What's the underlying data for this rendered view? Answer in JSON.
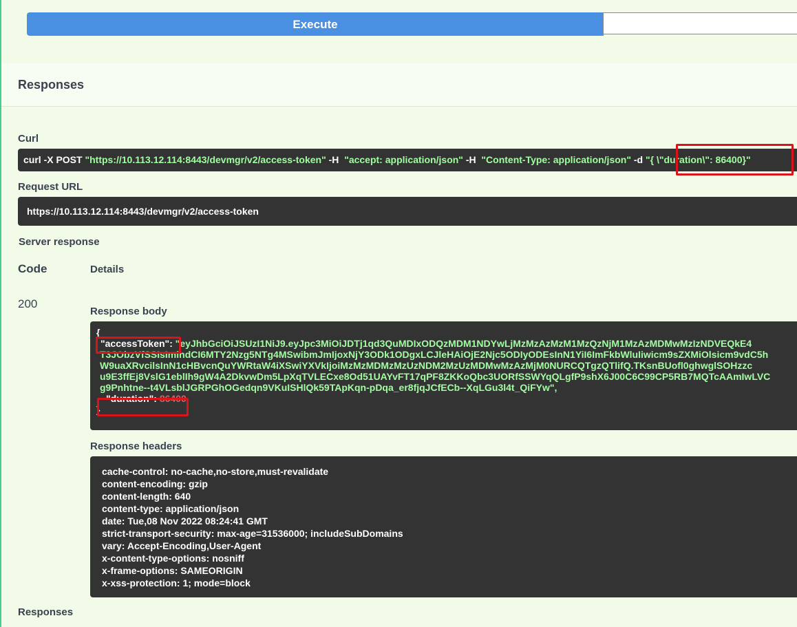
{
  "execute": {
    "label": "Execute"
  },
  "responses": {
    "title": "Responses"
  },
  "curl": {
    "label": "Curl",
    "prefix": "curl -X POST",
    "url": "\"https://10.113.12.114:8443/devmgr/v2/access-token\"",
    "h1": "-H",
    "accept": "\"accept: application/json\"",
    "h2": "-H",
    "content_type": "\"Content-Type: application/json\"",
    "d": "-d",
    "data": "\"{  \\\"duration\\\": 86400}\""
  },
  "request_url": {
    "label": "Request URL",
    "value": "https://10.113.12.114:8443/devmgr/v2/access-token"
  },
  "server_response": {
    "label": "Server response",
    "code_header": "Code",
    "details_header": "Details",
    "status_code": "200",
    "body_label": "Response body",
    "body": {
      "open": "{",
      "access_key": "\"accessToken\"",
      "colon": ":",
      "token_lines": [
        "\"eyJhbGciOiJSUzI1NiJ9.eyJpc3MiOiJDTj1qd3QuMDIxODQzMDM1NDYwLjMzMzAzMzM1MzQzNjM1MzAzMDMwMzIzNDVEQkE4",
        "T3JObzVfSSIsImlhdCI6MTY2Nzg5NTg4MSwibmJmIjoxNjY3ODk1ODgxLCJleHAiOjE2Njc5ODIyODEsInN1YiI6ImFkbWluIiwicm9sZXMiOlsicm9vdC5h",
        "W9uaXRvcilsInN1cHBvcnQuYWRtaW4iXSwiYXVkIjoiMzMzMDMzMzUzNDM2MzUzMDMwMzAzMjM0NURCQTgzQTlifQ.TKsnBUofl0ghwglSOHzzc",
        "u9E3ffEj8VslG1eblIh9gW4A2DkvwDm5LpXqTVLECxe8Od51UAYvFT17qPF8ZKKoQbc3UORfSSWYqQLgfP9shX6J00C6C99CP5RB7MQTcAAmIwLVC",
        "g9Pnhtne--t4VLsblJGRPGhOGedqn9VKuISHlQk59TApKqn-pDqa_er8fjqJCfECb--XqLGu3l4t_QiFYw\","
      ],
      "duration_key": "\"duration\"",
      "duration_colon": ":",
      "duration_value": "86400",
      "close": "}"
    },
    "headers_label": "Response headers",
    "headers": [
      "cache-control: no-cache,no-store,must-revalidate",
      "content-encoding: gzip",
      "content-length: 640",
      "content-type: application/json",
      "date: Tue,08 Nov 2022 08:24:41 GMT",
      "strict-transport-security: max-age=31536000; includeSubDomains",
      "vary: Accept-Encoding,User-Agent",
      "x-content-type-options: nosniff",
      "x-frame-options: SAMEORIGIN",
      "x-xss-protection: 1; mode=block"
    ]
  },
  "bottom": {
    "label": "Responses"
  },
  "colors": {
    "highlight": "#d9141a",
    "execute": "#4990e2",
    "string": "#a2fca2",
    "number": "#d36363"
  }
}
